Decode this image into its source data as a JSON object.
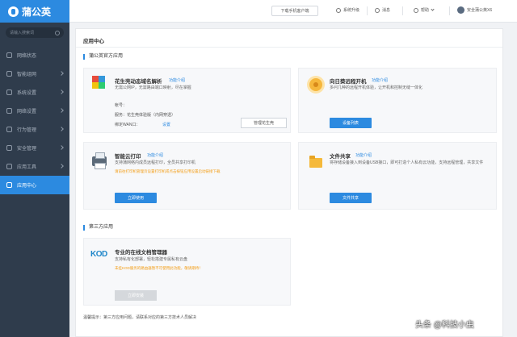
{
  "sidebar": {
    "brand": "蒲公英",
    "search_placeholder": "请输入搜索词",
    "items": [
      {
        "label": "网络状态",
        "icon": "network-status-icon"
      },
      {
        "label": "智能组网",
        "icon": "smart-networking-icon"
      },
      {
        "label": "系统设置",
        "icon": "system-settings-icon"
      },
      {
        "label": "网络设置",
        "icon": "network-settings-icon"
      },
      {
        "label": "行为管理",
        "icon": "behavior-management-icon"
      },
      {
        "label": "安全管理",
        "icon": "security-management-icon"
      },
      {
        "label": "应用工具",
        "icon": "app-tools-icon"
      },
      {
        "label": "应用中心",
        "icon": "app-center-icon",
        "active": true
      }
    ]
  },
  "topbar": {
    "download_client": "下载手机客户端",
    "upgrade": "系统升级",
    "messages": "消息",
    "help": "帮助",
    "device": "安全蒲公英X6"
  },
  "main": {
    "title": "应用中心",
    "official_section": "蒲公英官方应用",
    "third_section": "第三方应用",
    "footer": "温馨提示：第三方应用问题，请联系对应的第三方技术人员解决"
  },
  "cards": {
    "ddns": {
      "title": "花生壳动态域名解析",
      "link": "功能介绍",
      "desc": "无需公网IP，无需路由端口映射，尽在掌握",
      "account_label": "帐号：",
      "service_label": "服务：花生壳体验版（内网穿透）",
      "wan_label": "绑定WAN口：",
      "wan_value": "设置",
      "button": "管理花生壳"
    },
    "sunflower": {
      "title": "向日葵远程开机",
      "link": "功能介绍",
      "desc": "多问几种的远程开机体验，让开机和控制无缝一体化",
      "button": "设备列表"
    },
    "print": {
      "title": "智能云打印",
      "link": "功能介绍",
      "desc": "支持蒲网络内成员远程打印，全员共享打印机",
      "warn": "请前往打印机管理页设置打印机或点击按钮应用设置启动链接下载",
      "button": "立即使用"
    },
    "share": {
      "title": "文件共享",
      "link": "功能介绍",
      "desc": "将存储设备接入到设备USB接口，即可打造个人私有云功能，支持远程管理，共享文件",
      "button": "文件共享"
    },
    "kod": {
      "logo": "KOD",
      "title": "专业的在线文档管理器",
      "desc": "支持私有化部署，轻松搭建专属私有云盘",
      "warn": "未挂KOD服务的路由器暂不可使用此功能，敬请期待！",
      "button": "立即安装"
    }
  },
  "watermark": "头条 @科技小虫"
}
